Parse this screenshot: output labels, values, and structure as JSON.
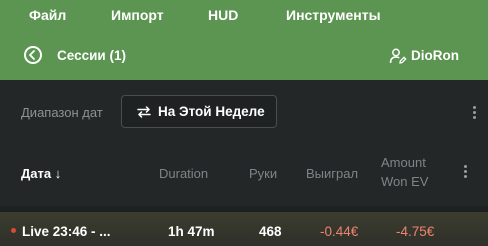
{
  "menu": {
    "file": "Файл",
    "import": "Импорт",
    "hud": "HUD",
    "tools": "Инструменты"
  },
  "session_bar": {
    "title": "Сессии (1)",
    "user": "DioRon"
  },
  "filter": {
    "label": "Диапазон дат",
    "value": "На Этой Неделе"
  },
  "table": {
    "headers": {
      "date": "Дата ↓",
      "duration": "Duration",
      "hands": "Руки",
      "won": "Выиграл",
      "won_ev_1": "Amount",
      "won_ev_2": "Won EV"
    },
    "rows": [
      {
        "date": "Live 23:46 - ...",
        "duration": "1h 47m",
        "hands": "468",
        "won": "-0.44€",
        "won_ev": "-4.75€"
      }
    ]
  },
  "colors": {
    "accent": "#5c9451",
    "negative": "#f0836f",
    "live": "#d94a3a"
  }
}
